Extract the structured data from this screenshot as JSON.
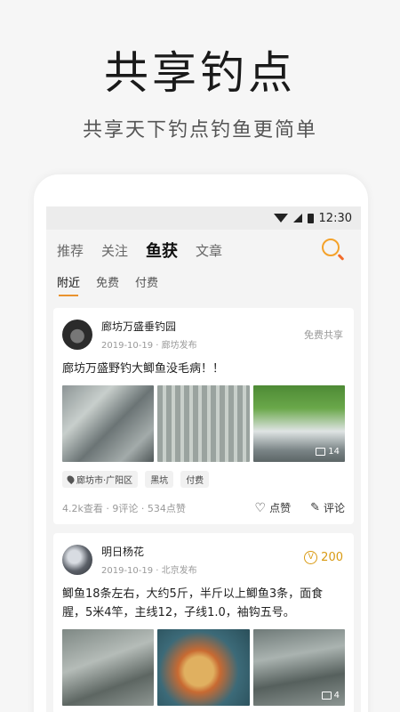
{
  "hero": {
    "title": "共享钓点",
    "subtitle": "共享天下钓点钓鱼更简单"
  },
  "status_bar": {
    "time": "12:30"
  },
  "tabs": [
    {
      "label": "推荐",
      "active": false
    },
    {
      "label": "关注",
      "active": false
    },
    {
      "label": "鱼获",
      "active": true
    },
    {
      "label": "文章",
      "active": false
    }
  ],
  "subtabs": [
    {
      "label": "附近",
      "active": true
    },
    {
      "label": "免费",
      "active": false
    },
    {
      "label": "付费",
      "active": false
    }
  ],
  "posts": [
    {
      "username": "廊坊万盛垂钓园",
      "info": "2019-10-19 · 廊坊发布",
      "badge": "免费共享",
      "text": "廊坊万盛野钓大鲫鱼没毛病！！",
      "photo_count": "14",
      "tags": [
        "廊坊市·广阳区",
        "黑坑",
        "付费"
      ],
      "stats": "4.2k查看 · 9评论 · 534点赞",
      "like_label": "点赞",
      "comment_label": "评论"
    },
    {
      "username": "明日杨花",
      "info": "2019-10-19 · 北京发布",
      "coins": "200",
      "coin_symbol": "V",
      "text": "鲫鱼18条左右，大约5斤，半斤以上鲫鱼3条，面食腥，5米4竿，主线12，子线1.0，袖钩五号。",
      "photo_count": "4"
    }
  ],
  "colors": {
    "accent": "#e9932f",
    "coin": "#d99a12"
  }
}
